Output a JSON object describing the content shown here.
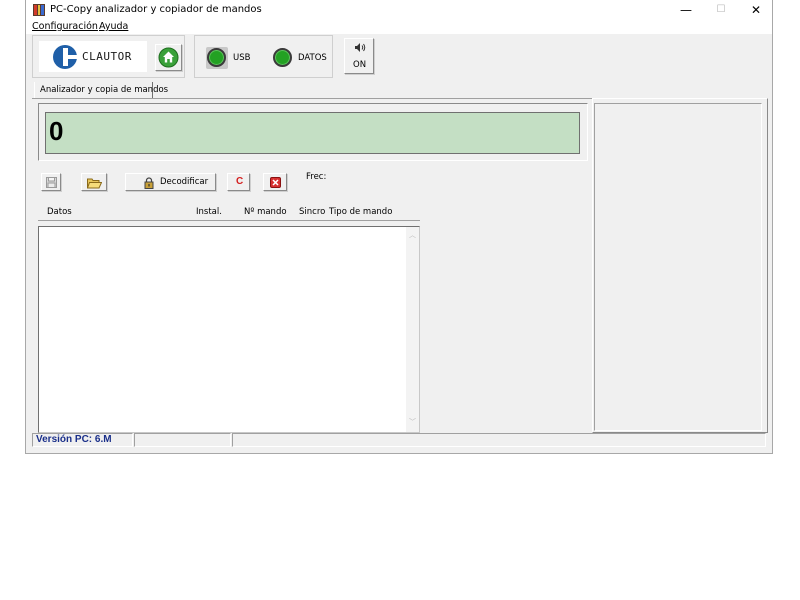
{
  "window": {
    "title": "PC-Copy analizador y copiador de mandos",
    "controls": {
      "minimize": "—",
      "maximize": "☐",
      "close": "✕"
    }
  },
  "menu": {
    "items": [
      "Configuración",
      "Ayuda"
    ]
  },
  "toolbar": {
    "logo_text": "CLAUTOR",
    "usb_label": "USB",
    "datos_label": "DATOS",
    "sound_state": "ON"
  },
  "tabs": [
    {
      "label": "Analizador y copia de mandos"
    }
  ],
  "display": {
    "value": "0",
    "background": "#c4dfc4"
  },
  "actions": {
    "decode_label": "Decodificar",
    "clear_label": "C",
    "frec_label": "Frec:"
  },
  "table": {
    "columns": [
      "Datos",
      "Instal.",
      "Nº mando",
      "Sincro",
      "Tipo de mando"
    ],
    "rows": []
  },
  "statusbar": {
    "version": "Versión PC: 6.M",
    "version_color": "#1a2f8a"
  },
  "colors": {
    "led_green": "#23a123",
    "logo_blue": "#1f5fa8",
    "home_green": "#3aa13a"
  }
}
